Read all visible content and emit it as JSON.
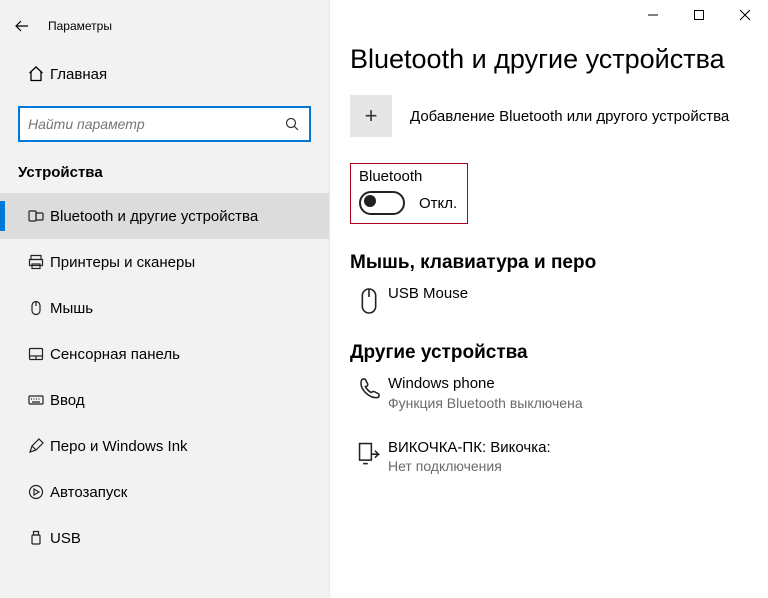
{
  "window": {
    "title": "Параметры"
  },
  "sidebar": {
    "home_label": "Главная",
    "search_placeholder": "Найти параметр",
    "category_title": "Устройства",
    "items": [
      {
        "label": "Bluetooth и другие устройства"
      },
      {
        "label": "Принтеры и сканеры"
      },
      {
        "label": "Мышь"
      },
      {
        "label": "Сенсорная панель"
      },
      {
        "label": "Ввод"
      },
      {
        "label": "Перо и Windows Ink"
      },
      {
        "label": "Автозапуск"
      },
      {
        "label": "USB"
      }
    ]
  },
  "page": {
    "title": "Bluetooth и другие устройства",
    "add_device_label": "Добавление Bluetooth или другого устройства",
    "bluetooth": {
      "heading": "Bluetooth",
      "state_label": "Откл."
    },
    "section1_title": "Мышь, клавиатура и перо",
    "devices1": [
      {
        "name": "USB Mouse",
        "sub": ""
      }
    ],
    "section2_title": "Другие устройства",
    "devices2": [
      {
        "name": "Windows phone",
        "sub": "Функция Bluetooth выключена"
      },
      {
        "name": "ВИКОЧКА-ПК: Викочка:",
        "sub": "Нет подключения"
      }
    ]
  }
}
